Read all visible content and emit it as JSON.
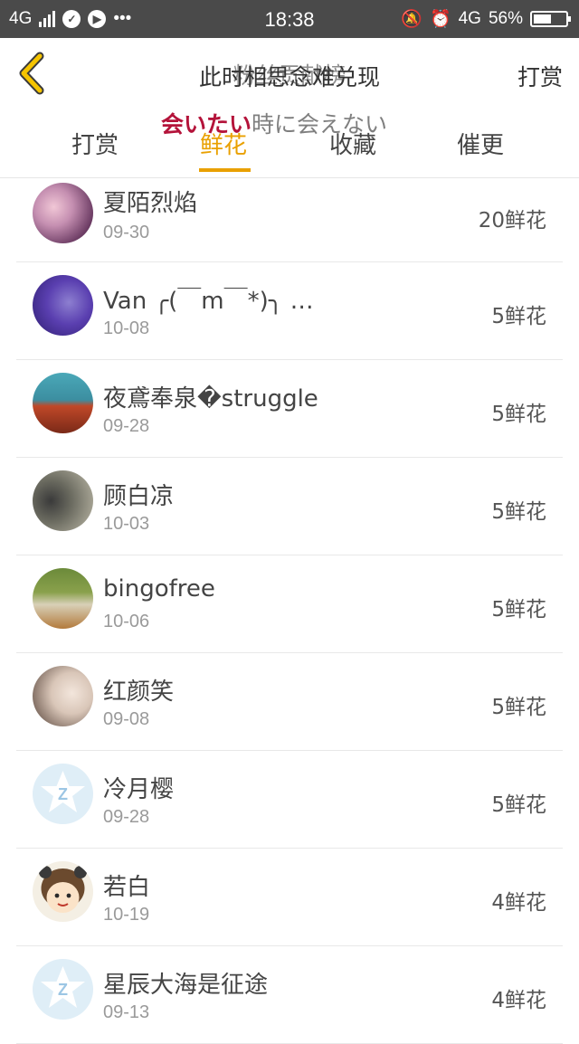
{
  "status_bar": {
    "network": "4G",
    "time": "18:38",
    "right_network": "4G",
    "battery": "56%",
    "battery_level": 0.56
  },
  "header": {
    "title": "此时相思念难兑现",
    "title_overlay": "粉丝贡献榜",
    "right_action": "打赏"
  },
  "overlay_caption": {
    "red": "会いたい",
    "rest": "時に会えない"
  },
  "tabs": [
    {
      "label": "打赏",
      "active": false
    },
    {
      "label": "鲜花",
      "active": true
    },
    {
      "label": "收藏",
      "active": false
    },
    {
      "label": "催更",
      "active": false
    }
  ],
  "accent_color": "#e9a000",
  "list": [
    {
      "name": "夏陌烈焰",
      "date": "09-30",
      "amount": "20鲜花"
    },
    {
      "name": "Van ╭(￣m￣*)╮ …",
      "date": "10-08",
      "amount": "5鲜花"
    },
    {
      "name": "夜鳶奉泉�struggle",
      "date": "09-28",
      "amount": "5鲜花"
    },
    {
      "name": "顾白凉",
      "date": "10-03",
      "amount": "5鲜花"
    },
    {
      "name": "bingofree",
      "date": "10-06",
      "amount": "5鲜花"
    },
    {
      "name": "红颜笑",
      "date": "09-08",
      "amount": "5鲜花"
    },
    {
      "name": "冷月樱",
      "date": "09-28",
      "amount": "5鲜花"
    },
    {
      "name": "若白",
      "date": "10-19",
      "amount": "4鲜花"
    },
    {
      "name": "星辰大海是征途",
      "date": "09-13",
      "amount": "4鲜花"
    }
  ]
}
